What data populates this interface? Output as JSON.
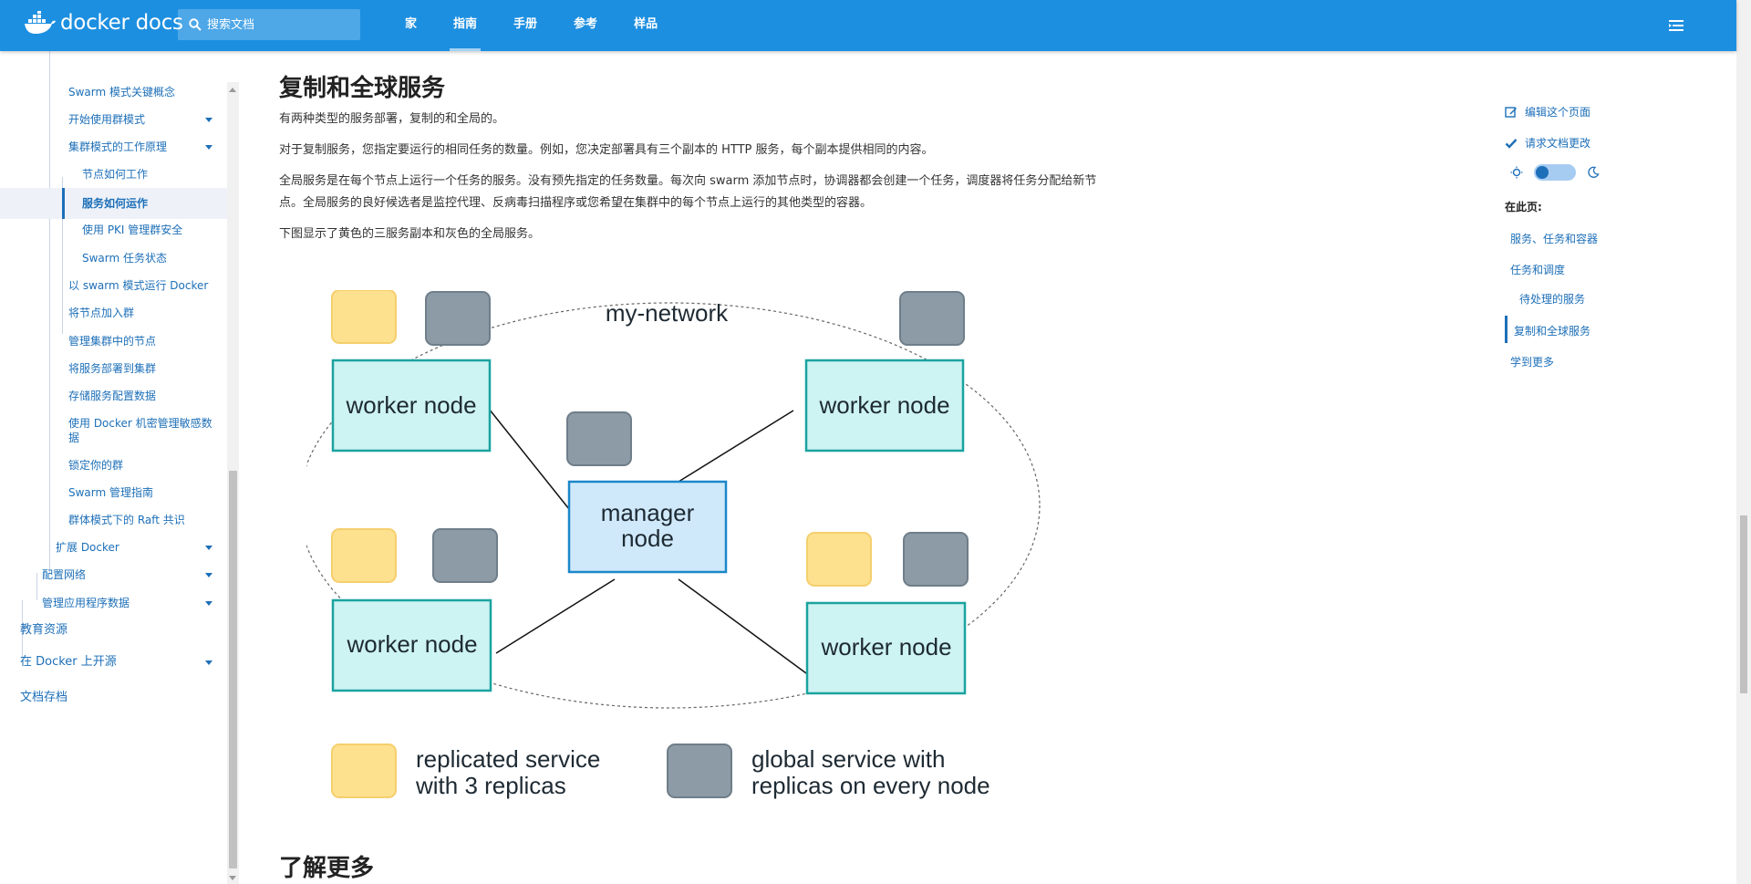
{
  "navbar": {
    "brand": "docker docs",
    "search_placeholder": "搜索文档",
    "links": [
      "家",
      "指南",
      "手册",
      "参考",
      "样品"
    ],
    "active_link": "指南",
    "accent_color": "#1d8fe0"
  },
  "sidebar": {
    "partial_top_item": "…",
    "items": [
      {
        "label": "Swarm 模式关键概念"
      },
      {
        "label": "开始使用群模式"
      },
      {
        "label": "集群模式的工作原理"
      },
      {
        "label": "节点如何工作"
      },
      {
        "label": "服务如何运作"
      },
      {
        "label": "使用 PKI 管理群安全"
      },
      {
        "label": "Swarm 任务状态"
      },
      {
        "label": "以 swarm 模式运行 Docker"
      },
      {
        "label": "将节点加入群"
      },
      {
        "label": "管理集群中的节点"
      },
      {
        "label": "将服务部署到集群"
      },
      {
        "label": "存储服务配置数据"
      },
      {
        "label": "使用 Docker 机密管理敏感数",
        "label2": "据"
      },
      {
        "label": "锁定你的群"
      },
      {
        "label": "Swarm 管理指南"
      },
      {
        "label": "群体模式下的 Raft 共识"
      },
      {
        "label": "扩展 Docker"
      },
      {
        "label": "配置网络"
      },
      {
        "label": "管理应用程序数据"
      },
      {
        "label": "教育资源"
      },
      {
        "label": "在 Docker 上开源"
      },
      {
        "label": "文档存档"
      }
    ]
  },
  "main": {
    "heading": "复制和全球服务",
    "paragraphs": [
      "有两种类型的服务部署，复制的和全局的。",
      "对于复制服务，您指定要运行的相同任务的数量。例如，您决定部署具有三个副本的 HTTP 服务，每个副本提供相同的内容。",
      "全局服务是在每个节点上运行一个任务的服务。没有预先指定的任务数量。每次向 swarm 添加节点时，协调器都会创建一个任务，调度器将任务分配给新节",
      "点。全局服务的良好候选者是监控代理、反病毒扫描程序或您希望在集群中的每个节点上运行的其他类型的容器。",
      "下图显示了黄色的三服务副本和灰色的全局服务。"
    ],
    "next_heading": "了解更多"
  },
  "diagram": {
    "network_label": "my-network",
    "worker_label": "worker node",
    "manager_label_line1": "manager",
    "manager_label_line2": "node",
    "legend_replicated_line1": "replicated service",
    "legend_replicated_line2": "with 3 replicas",
    "legend_global_line1": "global service with",
    "legend_global_line2": "replicas on every node",
    "colors": {
      "replicated": "#fde18e",
      "global": "#8d9ba6",
      "worker_fill": "#cdf3f2",
      "worker_stroke": "#1aa3a0",
      "manager_fill": "#cfe9fa",
      "manager_stroke": "#1c87c9"
    }
  },
  "toc": {
    "edit_page": "编辑这个页面",
    "request_change": "请求文档更改",
    "on_this_page": "在此页:",
    "links": [
      "服务、任务和容器",
      "任务和调度",
      "待处理的服务",
      "复制和全球服务",
      "学到更多"
    ],
    "active": "复制和全球服务"
  }
}
